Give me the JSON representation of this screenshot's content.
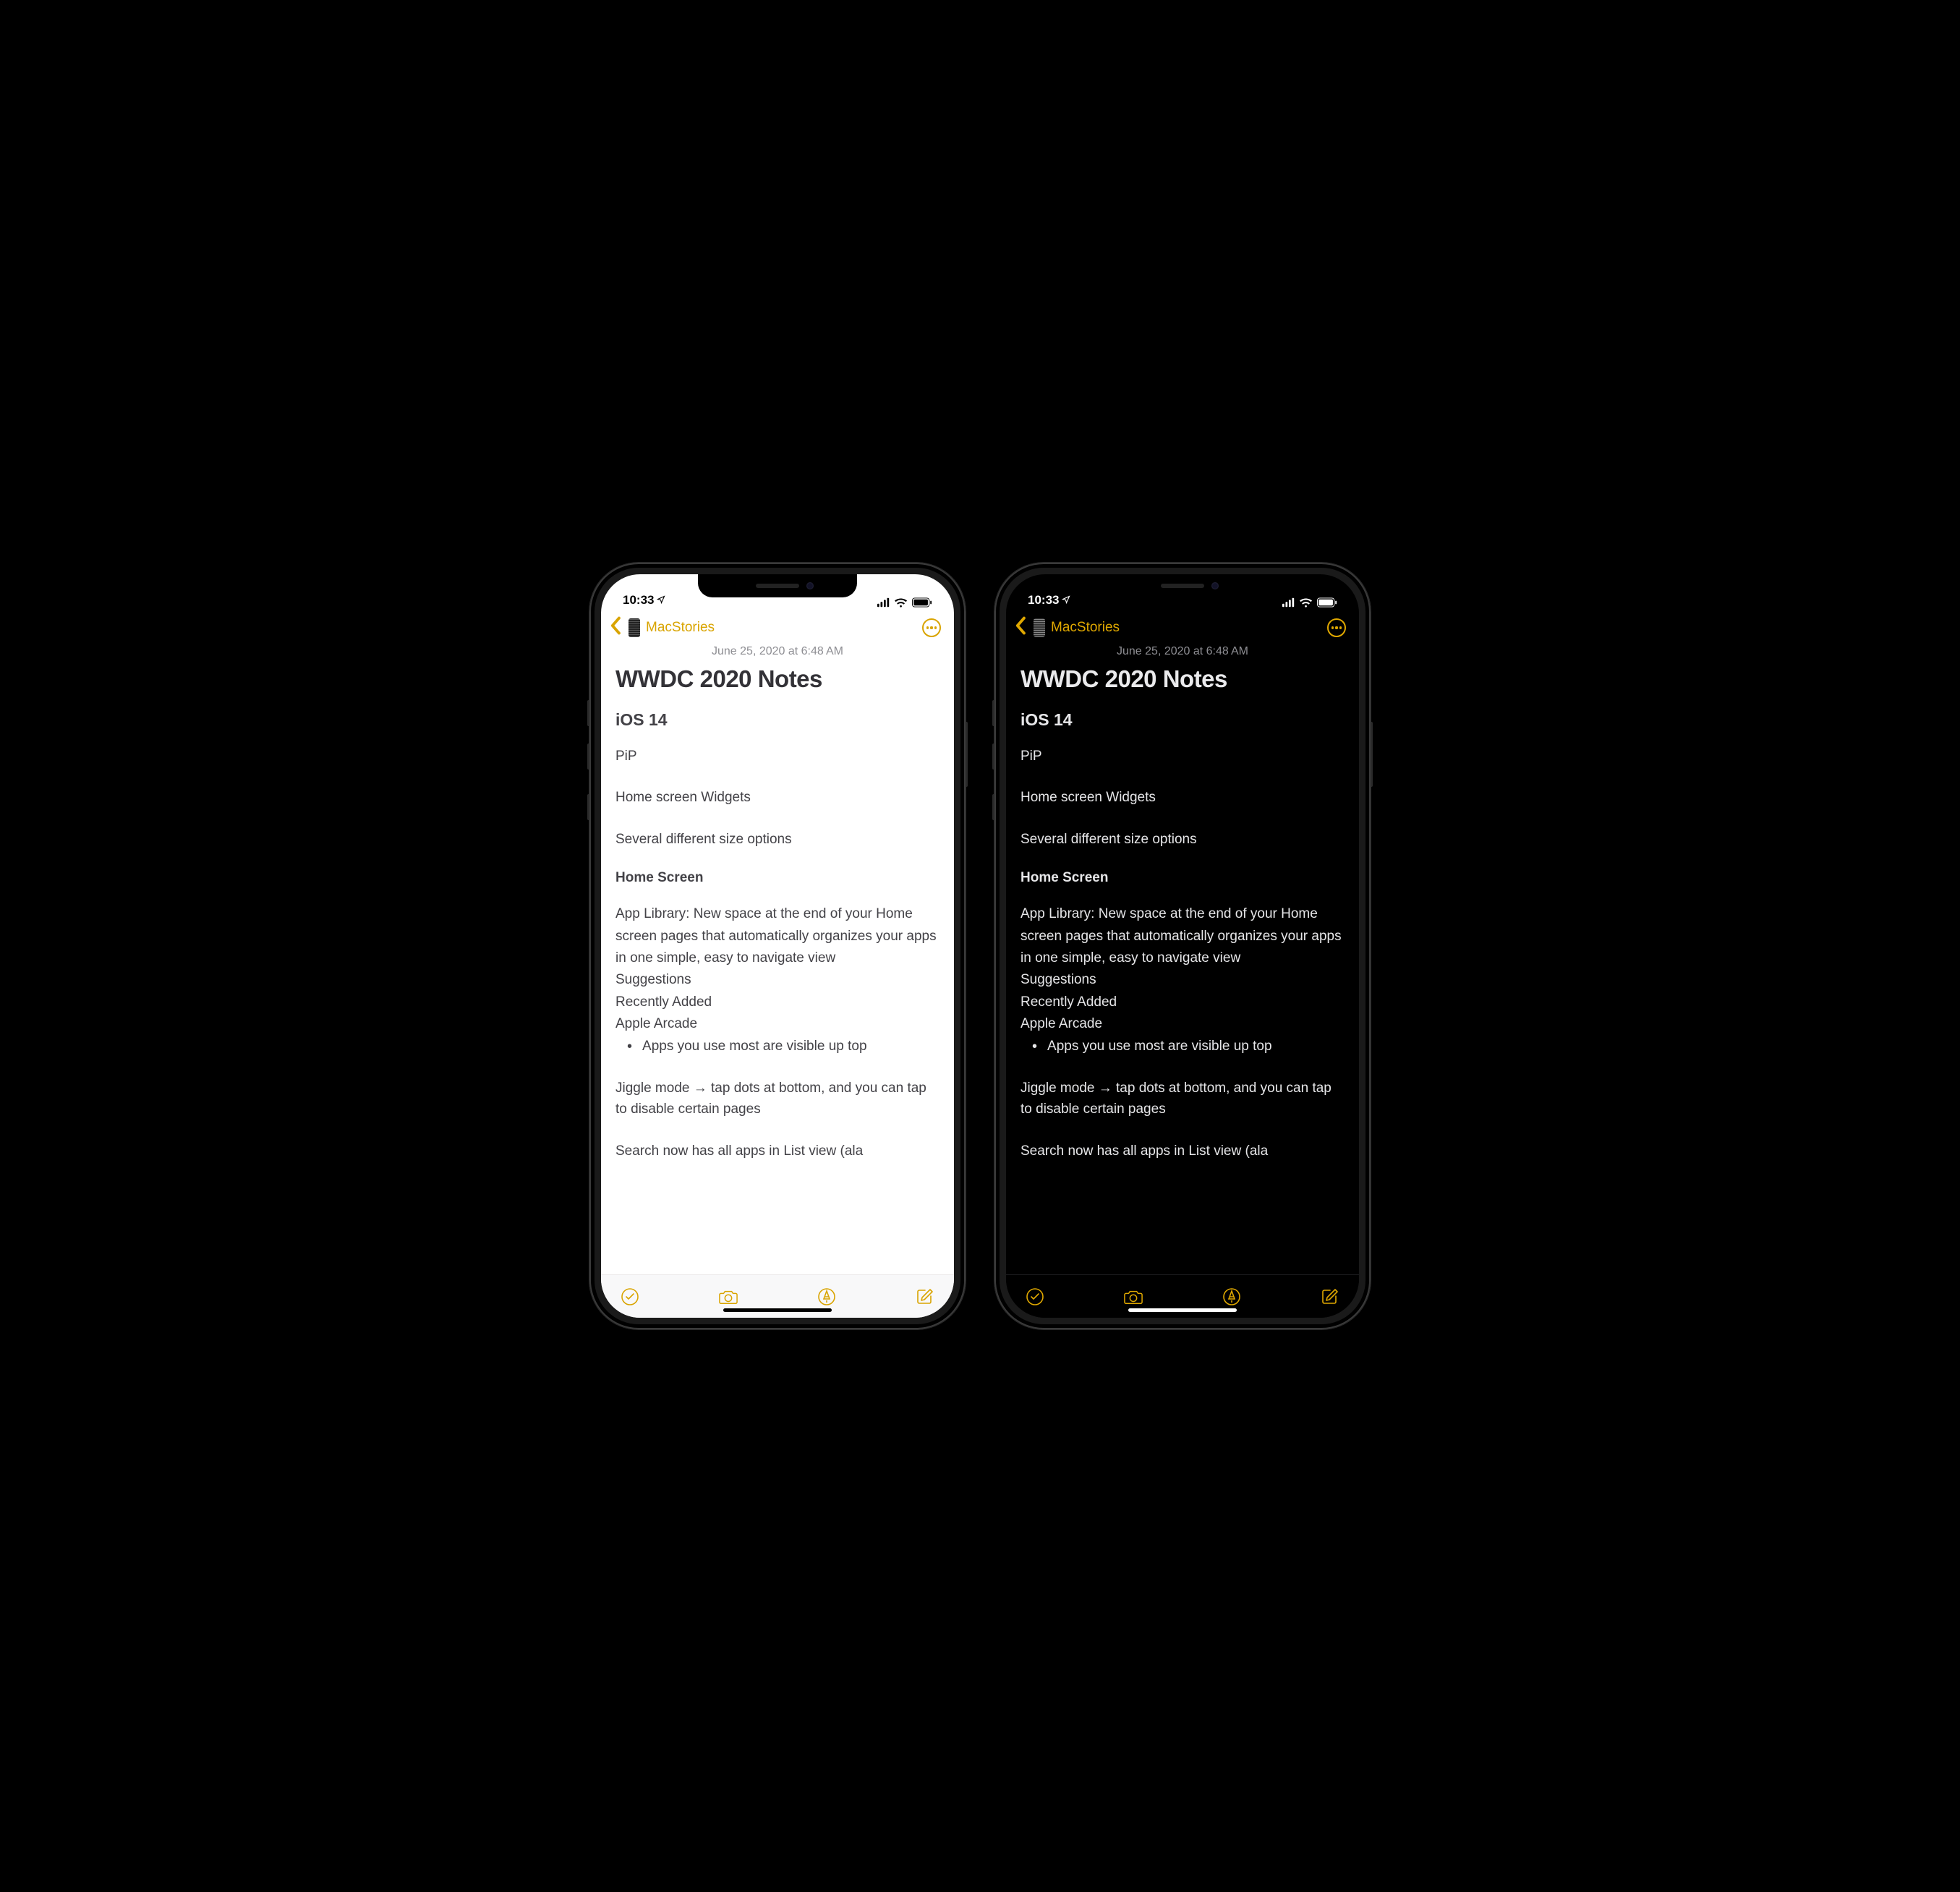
{
  "status": {
    "time": "10:33"
  },
  "nav": {
    "back_label": "MacStories"
  },
  "note": {
    "timestamp": "June 25, 2020 at 6:48 AM",
    "title": "WWDC 2020 Notes",
    "section_ios": "iOS 14",
    "line_pip": "PiP",
    "line_widgets": "Home screen Widgets",
    "line_sizes": "Several different size options",
    "section_home": "Home Screen",
    "para_applib": "App Library: New space at the end of your Home screen pages that automatically organizes your apps in one simple, easy to navigate view",
    "line_suggestions": "Suggestions",
    "line_recent": "Recently Added",
    "line_arcade": "Apple Arcade",
    "bullet_most": "Apps you use most are visible up top",
    "para_jiggle": "Jiggle mode → tap dots at bottom, and you can tap to disable certain pages",
    "para_search_cut": "Search now has all apps in List view (ala"
  }
}
